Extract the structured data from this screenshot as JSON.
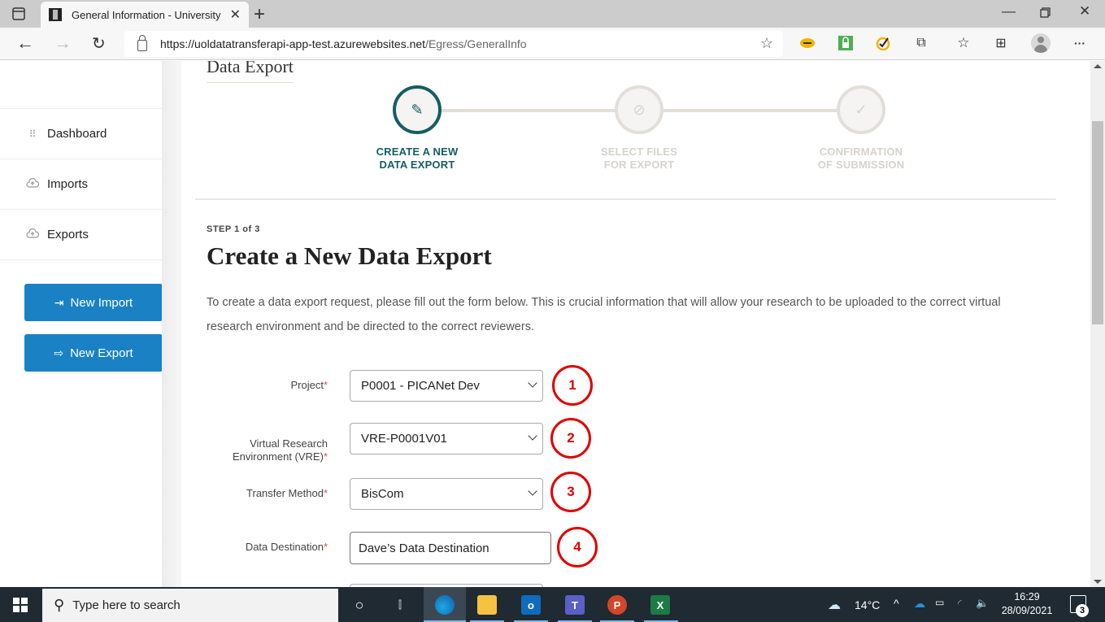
{
  "browser": {
    "tab_title": "General Information - University",
    "url_host": "https://uoldatatransferapi-app-test.azurewebsites.net",
    "url_path": "/Egress/GeneralInfo",
    "icons": [
      "tab-actions-icon",
      "back-icon",
      "forward-icon",
      "refresh-icon",
      "lock-icon",
      "add-favorite-icon",
      "key-extension-icon",
      "lock-extension-icon",
      "norton-check-icon",
      "extensions-puzzle-icon",
      "favorites-icon",
      "collections-icon",
      "profile-avatar",
      "more-menu-icon",
      "minimize-icon",
      "restore-icon",
      "close-icon"
    ]
  },
  "sidebar": {
    "items": [
      {
        "label": "Dashboard",
        "icon": "grid-icon"
      },
      {
        "label": "Imports",
        "icon": "cloud-upload-icon"
      },
      {
        "label": "Exports",
        "icon": "cloud-upload-icon"
      }
    ],
    "buttons": [
      {
        "label": "New Import",
        "icon": "import-icon"
      },
      {
        "label": "New Export",
        "icon": "export-icon"
      }
    ]
  },
  "header": {
    "brand_title": "Data Export"
  },
  "stepper": {
    "steps": [
      {
        "line1": "CREATE A NEW",
        "line2": "DATA EXPORT",
        "icon": "pencil-icon",
        "active": true
      },
      {
        "line1": "SELECT FILES",
        "line2": "FOR EXPORT",
        "icon": "paperclip-icon",
        "active": false
      },
      {
        "line1": "CONFIRMATION",
        "line2": "OF SUBMISSION",
        "icon": "check-icon",
        "active": false
      }
    ]
  },
  "main": {
    "step_count": "STEP 1 of 3",
    "heading": "Create a New Data Export",
    "intro": "To create a data export request, please fill out the form below. This is crucial information that will allow your research to be uploaded to the correct virtual research environment and be directed to the correct reviewers."
  },
  "form": {
    "required_marker": "*",
    "fields": [
      {
        "label": "Project",
        "type": "select",
        "value": "P0001 - PICANet Dev",
        "callout": "1"
      },
      {
        "label_line1": "Virtual Research",
        "label_line2": "Environment (VRE)",
        "type": "select",
        "value": "VRE-P0001V01",
        "callout": "2"
      },
      {
        "label": "Transfer Method",
        "type": "select",
        "value": "BisCom",
        "callout": "3"
      },
      {
        "label": "Data Destination",
        "type": "text",
        "value": "Dave’s Data Destination",
        "callout": "4"
      }
    ]
  },
  "taskbar": {
    "search_placeholder": "Type here to search",
    "weather": "14°C",
    "time": "16:29",
    "date": "28/09/2021",
    "notification_count": "3",
    "apps": [
      "cortana",
      "task-view",
      "edge",
      "file-explorer",
      "outlook",
      "teams",
      "powerpoint",
      "excel"
    ]
  },
  "colors": {
    "accent_teal": "#155e63",
    "button_blue": "#1a82c4",
    "callout_red": "#e00000",
    "required_red": "#d9534f"
  }
}
